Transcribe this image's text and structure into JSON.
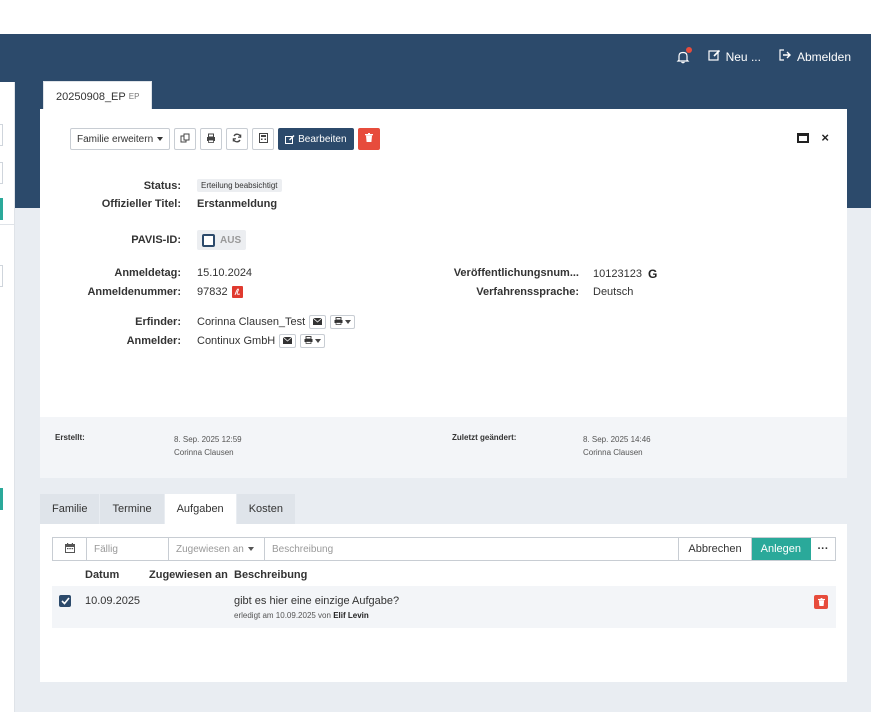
{
  "nav": {
    "new_label": "Neu ...",
    "logout_label": "Abmelden"
  },
  "record": {
    "tab_title": "20250908_EP",
    "tab_suffix": "EP"
  },
  "toolbar": {
    "family_label": "Familie erweitern",
    "edit_label": "Bearbeiten"
  },
  "details": {
    "status_label": "Status:",
    "status_value": "Erteilung beabsichtigt",
    "title_label": "Offizieller Titel:",
    "title_value": "Erstanmeldung",
    "pavis_label": "PAVIS-ID:",
    "pavis_toggle": "AUS",
    "filing_date_label": "Anmeldetag:",
    "filing_date_value": "15.10.2024",
    "app_number_label": "Anmeldenummer:",
    "app_number_value": "97832",
    "pub_number_label": "Veröffentlichungsnum...",
    "pub_number_value": "10123123",
    "pub_mark": "G",
    "language_label": "Verfahrenssprache:",
    "language_value": "Deutsch",
    "inventor_label": "Erfinder:",
    "inventor_value": "Corinna Clausen_Test",
    "applicant_label": "Anmelder:",
    "applicant_value": "Continux GmbH"
  },
  "meta": {
    "created_label": "Erstellt:",
    "created_date": "8. Sep. 2025 12:59",
    "created_by": "Corinna Clausen",
    "changed_label": "Zuletzt geändert:",
    "changed_date": "8. Sep. 2025 14:46",
    "changed_by": "Corinna Clausen"
  },
  "tabs": [
    {
      "label": "Familie"
    },
    {
      "label": "Termine"
    },
    {
      "label": "Aufgaben"
    },
    {
      "label": "Kosten"
    }
  ],
  "task_form": {
    "due_placeholder": "Fällig",
    "assigned_placeholder": "Zugewiesen an",
    "desc_placeholder": "Beschreibung",
    "cancel_label": "Abbrechen",
    "create_label": "Anlegen",
    "more_label": "···"
  },
  "task_table": {
    "col_date": "Datum",
    "col_assigned": "Zugewiesen an",
    "col_desc": "Beschreibung",
    "rows": [
      {
        "date": "10.09.2025",
        "description": "gibt es hier eine einzige Aufgabe?",
        "done_prefix": "erledigt am 10.09.2025 von",
        "done_by": "Elif Levin"
      }
    ]
  },
  "colors": {
    "navbar": "#2c4a6b",
    "accent_green": "#2aa99a",
    "danger": "#e74c3c"
  }
}
